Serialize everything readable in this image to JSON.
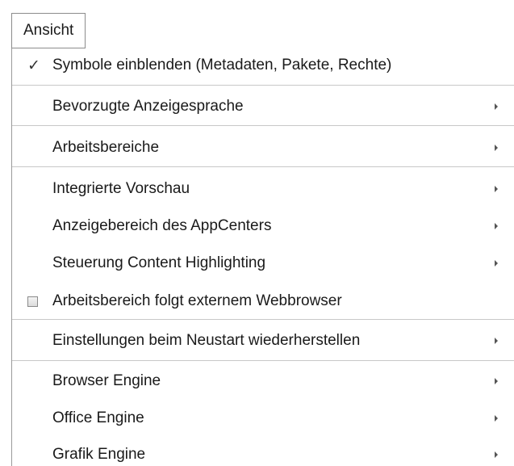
{
  "menu_button": {
    "label": "Ansicht"
  },
  "menu": {
    "items": [
      {
        "label": "Symbole einblenden (Metadaten, Pakete, Rechte)",
        "checked": true,
        "has_submenu": false
      },
      {
        "label": "Bevorzugte Anzeigesprache",
        "has_submenu": true
      },
      {
        "label": "Arbeitsbereiche",
        "has_submenu": true
      },
      {
        "label": "Integrierte Vorschau",
        "has_submenu": true
      },
      {
        "label": "Anzeigebereich des AppCenters",
        "has_submenu": true
      },
      {
        "label": "Steuerung Content Highlighting",
        "has_submenu": true
      },
      {
        "label": "Arbeitsbereich folgt externem Webbrowser",
        "checkbox": true,
        "checked": false,
        "has_submenu": false
      },
      {
        "label": "Einstellungen beim Neustart wiederherstellen",
        "has_submenu": true
      },
      {
        "label": "Browser Engine",
        "has_submenu": true
      },
      {
        "label": "Office Engine",
        "has_submenu": true
      },
      {
        "label": "Grafik Engine",
        "has_submenu": true
      }
    ]
  },
  "icons": {
    "check": "check-icon",
    "checkbox": "checkbox-icon",
    "submenu_arrow": "submenu-arrow-icon"
  },
  "colors": {
    "background": "#ffffff",
    "border": "#8c8c8c",
    "separator": "#c8c8c8",
    "text": "#1a1a1a"
  }
}
